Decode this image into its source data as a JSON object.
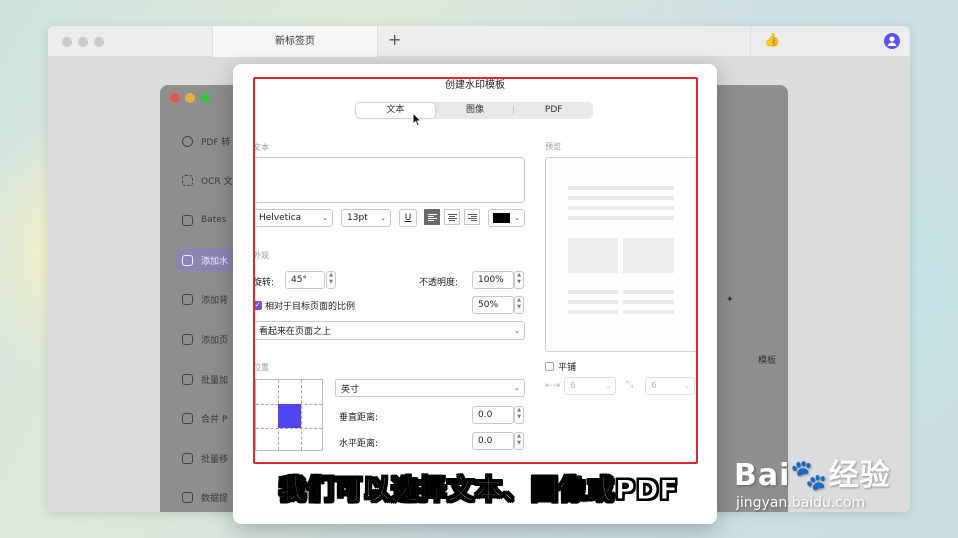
{
  "browser": {
    "tab_title": "新标签页",
    "new_tab_symbol": "+",
    "thumb_symbol": "👍",
    "avatar_symbol": "👤"
  },
  "sidebar": {
    "items": [
      {
        "label": "PDF 转",
        "icon": "refresh-icon"
      },
      {
        "label": "OCR 文",
        "icon": "scan-icon"
      },
      {
        "label": "Bates",
        "icon": "bates-icon"
      },
      {
        "label": "添加水",
        "icon": "watermark-icon",
        "active": true
      },
      {
        "label": "添加背",
        "icon": "background-icon"
      },
      {
        "label": "添加页",
        "icon": "page-icon"
      },
      {
        "label": "批量加",
        "icon": "lock-icon"
      },
      {
        "label": "合并 P",
        "icon": "merge-icon"
      },
      {
        "label": "批量移",
        "icon": "trash-icon"
      },
      {
        "label": "数据提",
        "icon": "export-icon"
      }
    ],
    "right_label": "模板"
  },
  "dialog": {
    "title": "创建水印模板",
    "tabs": [
      "文本",
      "图像",
      "PDF"
    ],
    "active_tab": "文本",
    "text_section_label": "文本",
    "text_value": "",
    "font": "Helvetica",
    "font_size": "13pt",
    "underline_symbol": "U",
    "color_swatch": "#000000",
    "appearance_label": "外观",
    "rotation_label": "旋转:",
    "rotation_value": "45°",
    "opacity_label": "不透明度:",
    "opacity_value": "100%",
    "relative_label": "相对于目标页面的比例",
    "relative_checked": true,
    "relative_value": "50%",
    "layer_value": "看起来在页面之上",
    "position_label": "位置",
    "unit_value": "英寸",
    "vertical_label": "垂直距离:",
    "vertical_value": "0.0",
    "horizontal_label": "水平距离:",
    "horizontal_value": "0.0",
    "preview_label": "预览",
    "tile_label": "平铺",
    "tile_checked": false,
    "tile_x_value": "6",
    "tile_y_value": "6"
  },
  "overlay": {
    "caption": "我们可以选择文本、图像或PDF",
    "watermark_brand": "Bai🐾经验",
    "watermark_url": "jingyan.baidu.com"
  },
  "colors": {
    "accent": "#5046f0",
    "highlight_frame": "#e0272d"
  }
}
